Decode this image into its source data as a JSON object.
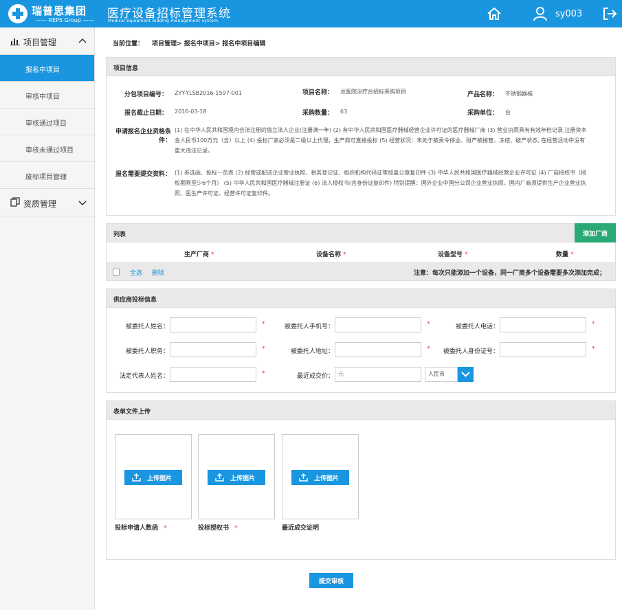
{
  "header": {
    "brand_cn": "瑞普思集团",
    "brand_en": "—— REPS Group ——",
    "system_cn": "医疗设备招标管理系统",
    "system_en": "Medical equipment bidding management system",
    "username": "sy003"
  },
  "sidebar": {
    "group1": "项目管理",
    "items": [
      "报名中项目",
      "审核中项目",
      "审核通过项目",
      "审核未通过项目",
      "废标项目管理"
    ],
    "group2": "资质管理"
  },
  "breadcrumb": {
    "label": "当前位置：",
    "path": "项目管理> 报名中项目> 报名中项目编辑"
  },
  "project_info": {
    "title": "项目信息",
    "sub_no_label": "分包项目编号：",
    "sub_no": "ZYY-YLSB2016-1597-001",
    "name_label": "项目名称：",
    "name": "总医院治疗台招标采购项目",
    "product_label": "产品名称：",
    "product": "不锈钢器械",
    "deadline_label": "报名截止日期：",
    "deadline": "2016-03-18",
    "qty_label": "采购数量：",
    "qty": "63",
    "unit_label": "采购单位：",
    "unit": "台",
    "qual_label_1": "申请报名企业资格条",
    "qual_label_2": "件：",
    "qual_lines": [
      "(1) 在中华人民共和国境内合法注册的独立法人企业(注册满一年) (2) 有中华人民共和国医疗器械经营企业许可证的医疗器械厂商 (3) 营业执照具有有效年检记录,注册资本",
      "金人民币100万元（含）以上 (4) 投标厂家必须是二级以上代理，生产商可直接投标 (5) 经营状况：未处于被责令停业、财产被接管、冻结、破产状态, 在经营活动中没有",
      "重大违法记录。"
    ],
    "docs_label": "报名需要提交资料：",
    "docs_lines": [
      "(1) 参选函、投标一览表 (2) 经营或配送企业营业执照、税务登记证、组织机构代码证等加盖公章复印件 (3) 中华人民共和国医疗器械经营企业许可证 (4) 厂商授权书（授",
      "权期限至少6个月） (5) 中华人民共和国医疗器械注册证 (6) 法人授权书(含身份证复印件) 特别提醒：国外企业中国分公司企业营业执照，国内厂商须提供生产企业营业执",
      "照、医生产许可证、经营许可证复印件。"
    ]
  },
  "list": {
    "title": "列表",
    "add_button": "添加厂商",
    "columns": [
      "生产厂商",
      "设备名称",
      "设备型号",
      "数量"
    ],
    "select_all": "全选",
    "delete": "删除",
    "notice": "注意：每次只能添加一个设备，同一厂商多个设备需要多次添加完成；"
  },
  "supplier": {
    "title": "供应商投标信息",
    "fields": {
      "name": "被委托人姓名：",
      "phone": "被委托人手机号：",
      "tel": "被委托人电话：",
      "position": "被委托人职务：",
      "address": "被委托人地址：",
      "idcard": "被委托人身份证号：",
      "legal": "法定代表人姓名：",
      "price": "最近成交价："
    },
    "price_placeholder": "元",
    "currency": "人民币"
  },
  "upload": {
    "title": "表单文件上传",
    "button": "上传图片",
    "captions": [
      "投标申请人数函",
      "投标授权书",
      "最近成交证明"
    ]
  },
  "submit": "提交审核",
  "required": "*",
  "colors": {
    "primary": "#1a96e0",
    "green": "#2aa876",
    "required": "#e33333"
  }
}
